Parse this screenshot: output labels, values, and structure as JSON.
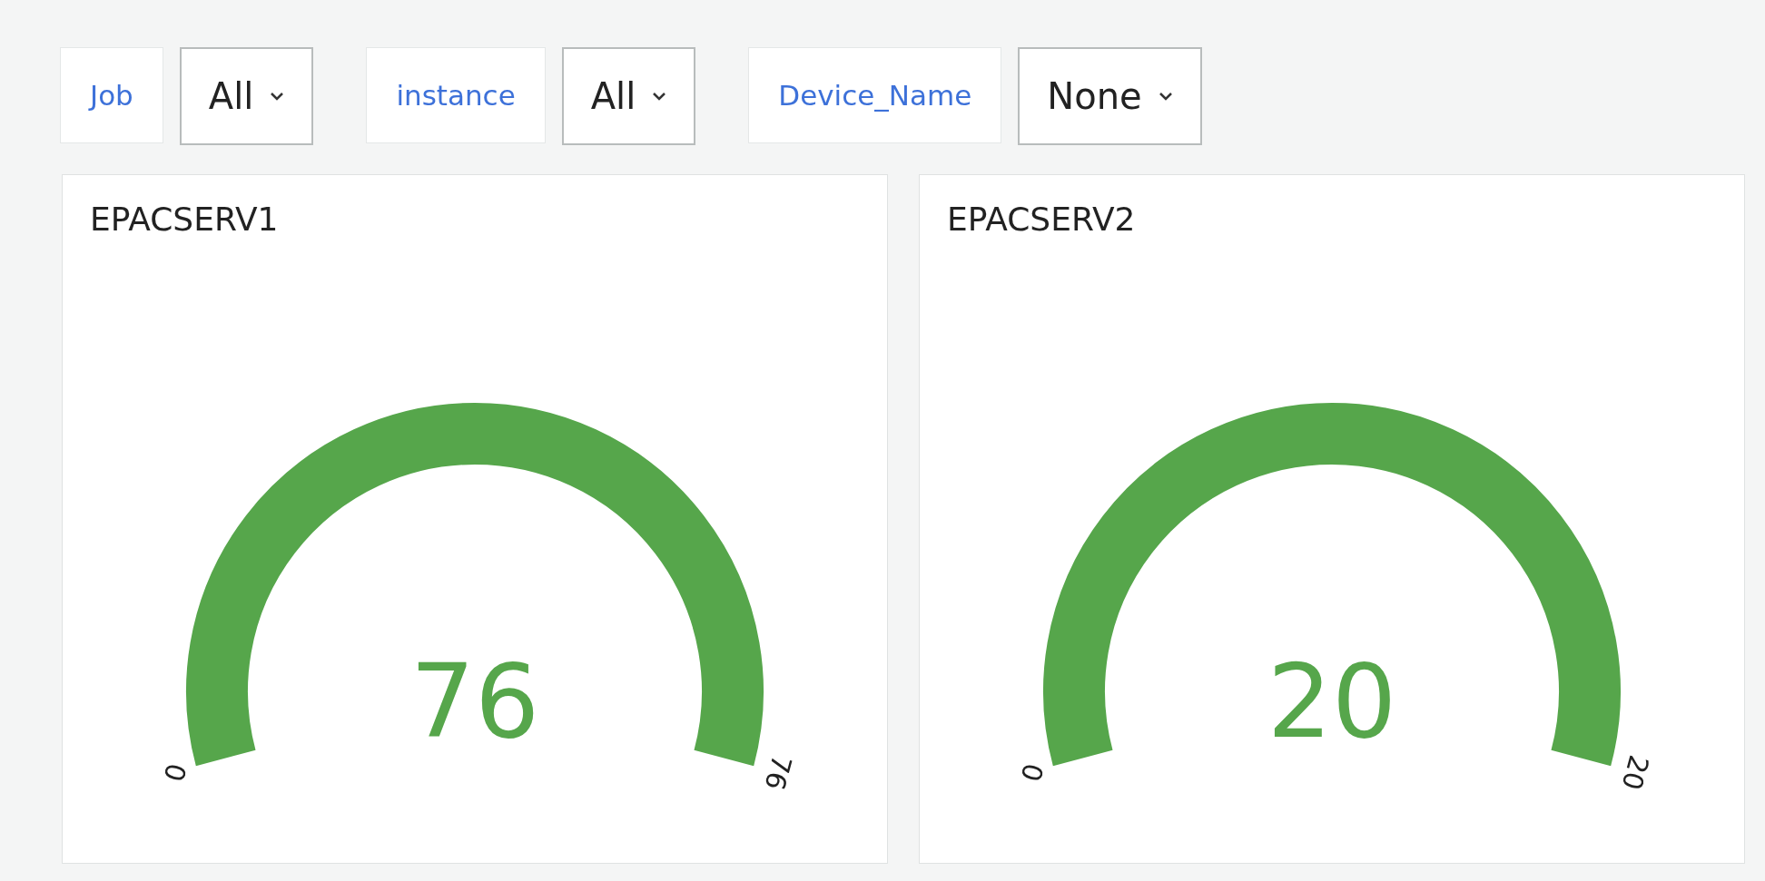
{
  "variables": [
    {
      "label": "Job",
      "value": "All"
    },
    {
      "label": "instance",
      "value": "All"
    },
    {
      "label": "Device_Name",
      "value": "None"
    }
  ],
  "panels": [
    {
      "title": "EPACSERV1",
      "value": "76",
      "min_label": "0",
      "max_label": "76"
    },
    {
      "title": "EPACSERV2",
      "value": "20",
      "min_label": "0",
      "max_label": "20"
    }
  ]
}
